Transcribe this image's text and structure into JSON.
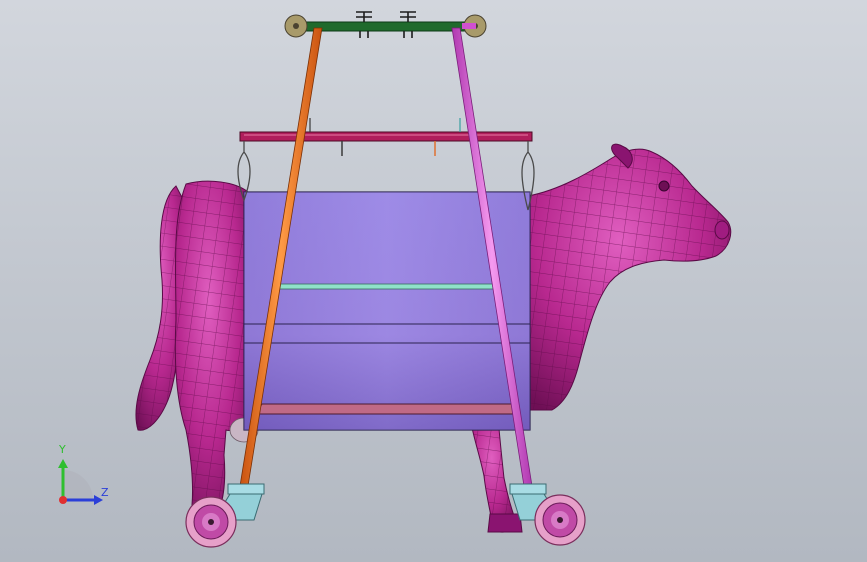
{
  "viewport": {
    "triad": {
      "y_label": "Y",
      "z_label": "Z"
    }
  },
  "model": {
    "components": [
      "cow-body",
      "sling-drum",
      "spreader-bar",
      "top-beam",
      "left-pole",
      "right-pole",
      "left-caster",
      "right-caster"
    ]
  },
  "colors": {
    "cow": "#b8288f",
    "cow_dark": "#6e0f55",
    "drum": "#9a84df",
    "pole_left": "#f27420",
    "pole_right": "#dd55d8",
    "spreader": "#b01e5c",
    "top_beam": "#1f6a2c",
    "caster_bracket": "#94d0d8",
    "wheel": "#e6a0c9",
    "axis_x": "#e03030",
    "axis_y": "#2fbf2f",
    "axis_z": "#2b3fd8"
  }
}
